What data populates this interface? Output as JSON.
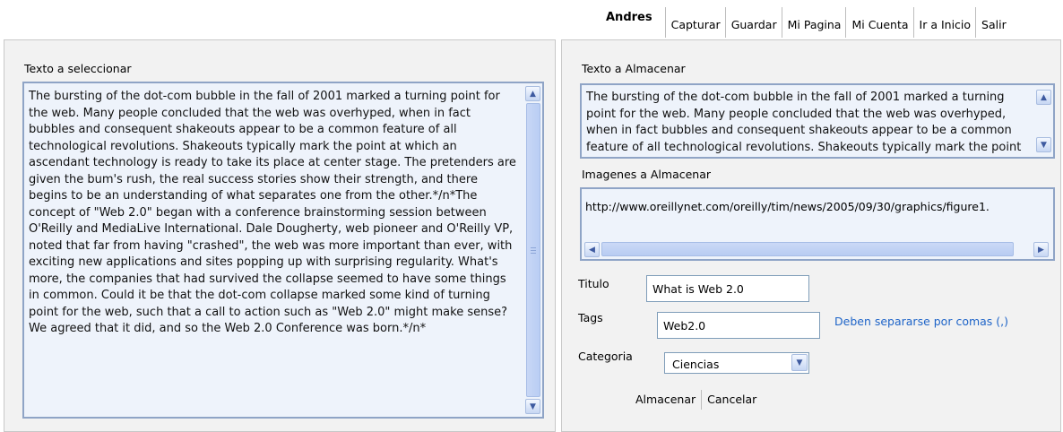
{
  "header": {
    "user": "Andres",
    "nav": [
      "Capturar",
      "Guardar",
      "Mi Pagina",
      "Mi Cuenta",
      "Ir a Inicio",
      "Salir"
    ]
  },
  "left_panel": {
    "label": "Texto a seleccionar",
    "text": "The bursting of the dot-com bubble in the fall of 2001 marked a turning point for the web. Many people concluded that the web was overhyped, when in fact bubbles and consequent shakeouts appear to be a common feature of all technological revolutions. Shakeouts typically mark the point at which an ascendant technology is ready to take its place at center stage. The pretenders are given the bum's rush, the real success stories show their strength, and there begins to be an understanding of what separates one from the other.*/n*The concept of \"Web 2.0\" began with a conference brainstorming session between O'Reilly and MediaLive International. Dale Dougherty, web pioneer and O'Reilly VP, noted that far from having \"crashed\", the web was more important than ever, with exciting new applications and sites popping up with surprising regularity. What's more, the companies that had survived the collapse seemed to have some things in common. Could it be that the dot-com collapse marked some kind of turning point for the web, such that a call to action such as \"Web 2.0\" might make sense? We agreed that it did, and so the Web 2.0 Conference was born.*/n*"
  },
  "right_panel": {
    "text_label": "Texto a Almacenar",
    "text": "The bursting of the dot-com bubble in the fall of 2001 marked a turning point for the web. Many people concluded that the web was overhyped, when in fact bubbles and consequent shakeouts appear to be a common feature of all technological revolutions. Shakeouts typically mark the point at which an ascendant technology is ready to take its place at center stage.",
    "images_label": "Imagenes a Almacenar",
    "image_url": "http://www.oreillynet.com/oreilly/tim/news/2005/09/30/graphics/figure1.",
    "titulo_label": "Titulo",
    "titulo_value": "What is Web 2.0",
    "tags_label": "Tags",
    "tags_value": "Web2.0",
    "tags_hint": "Deben separarse por comas (,)",
    "categoria_label": "Categoria",
    "categoria_value": "Ciencias",
    "save_label": "Almacenar",
    "cancel_label": "Cancelar"
  },
  "icons": {
    "scroll_up": "scroll-up-icon",
    "scroll_down": "scroll-down-icon",
    "scroll_left": "scroll-left-icon",
    "scroll_right": "scroll-right-icon",
    "dropdown": "chevron-down-icon"
  }
}
